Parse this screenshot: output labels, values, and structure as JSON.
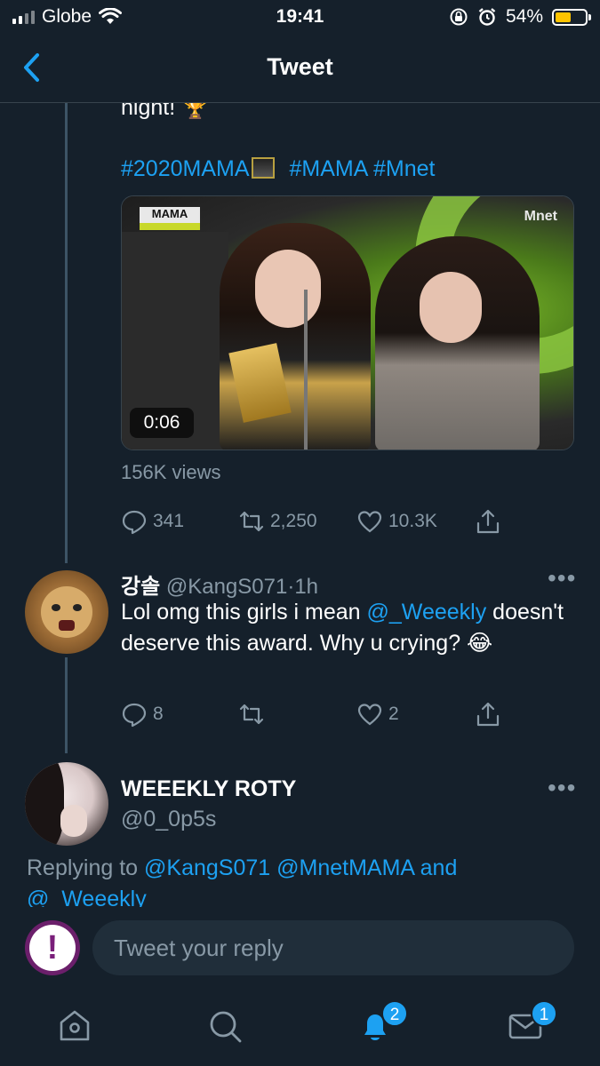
{
  "status_bar": {
    "carrier": "Globe",
    "time": "19:41",
    "battery_percent": "54%",
    "battery_level": 0.54,
    "battery_color": "#ffc400"
  },
  "header": {
    "title": "Tweet",
    "back_icon": "chevron-left-icon"
  },
  "main_tweet": {
    "text_tail": "night! 🏆",
    "hashtags": [
      "#2020MAMA",
      "#MAMA",
      "#Mnet"
    ],
    "media": {
      "duration": "0:06",
      "badge_left": "MAMA",
      "badge_right": "Mnet"
    },
    "views": "156K views",
    "actions": {
      "replies": "341",
      "retweets": "2,250",
      "likes": "10.3K"
    }
  },
  "reply_1": {
    "name": "강솔",
    "handle": "@KangS071",
    "time": "1h",
    "text_before": "Lol omg this girls i mean ",
    "mention": "@_Weeekly",
    "text_after": " doesn't deserve this award. Why u crying? 😂",
    "actions": {
      "replies": "8",
      "likes": "2"
    }
  },
  "reply_2": {
    "name": "WEEEKLY ROTY",
    "handle": "@0_0p5s",
    "replying_label": "Replying to",
    "replying_mentions": "@KangS071 @MnetMAMA and",
    "replying_cut": "@_Weeekly"
  },
  "composer": {
    "placeholder": "Tweet your reply"
  },
  "tabbar": {
    "items": [
      "home-icon",
      "search-icon",
      "notifications-icon",
      "messages-icon"
    ],
    "notifications_badge": "2",
    "messages_badge": "1"
  },
  "colors": {
    "background": "#15202b",
    "accent": "#1da1f2",
    "muted": "#8899a6",
    "divider": "#38444d"
  }
}
